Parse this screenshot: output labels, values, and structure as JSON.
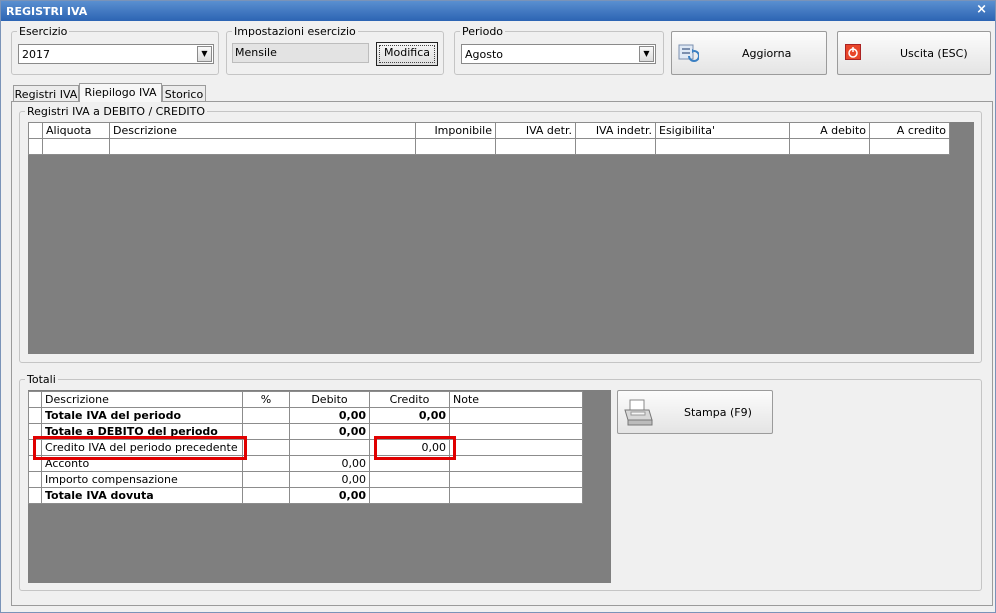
{
  "window": {
    "title": "REGISTRI IVA",
    "close_glyph": "×"
  },
  "esercizio": {
    "legend": "Esercizio",
    "value": "2017"
  },
  "impostazioni": {
    "legend": "Impostazioni esercizio",
    "value": "Mensile",
    "button": "Modifica"
  },
  "periodo": {
    "legend": "Periodo",
    "value": "Agosto"
  },
  "toolbar": {
    "aggiorna": "Aggiorna",
    "uscita": "Uscita (ESC)"
  },
  "tabs": [
    {
      "label": "Registri IVA",
      "active": false
    },
    {
      "label": "Riepilogo IVA",
      "active": true
    },
    {
      "label": "Storico",
      "active": false
    }
  ],
  "registri": {
    "legend": "Registri IVA a DEBITO / CREDITO",
    "columns": [
      "Aliquota",
      "Descrizione",
      "Imponibile",
      "IVA detr.",
      "IVA indetr.",
      "Esigibilita'",
      "A debito",
      "A credito"
    ],
    "rows": [
      [
        "",
        "",
        "",
        "",
        "",
        "",
        "",
        ""
      ]
    ]
  },
  "totali": {
    "legend": "Totali",
    "columns": [
      "Descrizione",
      "%",
      "Debito",
      "Credito",
      "Note"
    ],
    "rows": [
      {
        "descrizione": "Totale IVA del periodo",
        "perc": "",
        "debito": "0,00",
        "credito": "0,00",
        "note": "",
        "bold": true
      },
      {
        "descrizione": "Totale a DEBITO del periodo",
        "perc": "",
        "debito": "0,00",
        "credito": "",
        "note": "",
        "bold": true
      },
      {
        "descrizione": "Credito IVA del periodo precedente",
        "perc": "",
        "debito": "",
        "credito": "0,00",
        "note": "",
        "bold": false
      },
      {
        "descrizione": "Acconto",
        "perc": "",
        "debito": "0,00",
        "credito": "",
        "note": "",
        "bold": false
      },
      {
        "descrizione": "Importo compensazione",
        "perc": "",
        "debito": "0,00",
        "credito": "",
        "note": "",
        "bold": false
      },
      {
        "descrizione": "Totale IVA dovuta",
        "perc": "",
        "debito": "0,00",
        "credito": "",
        "note": "",
        "bold": true
      }
    ],
    "stampa": "Stampa (F9)"
  },
  "icons": {
    "refresh": "refresh-icon",
    "exit": "power-icon",
    "printer": "printer-icon"
  },
  "colors": {
    "title_bar": "#2c64b3",
    "grid_bg": "#7f7f7f",
    "highlight": "#e00000",
    "exit_icon": "#e8462a"
  }
}
